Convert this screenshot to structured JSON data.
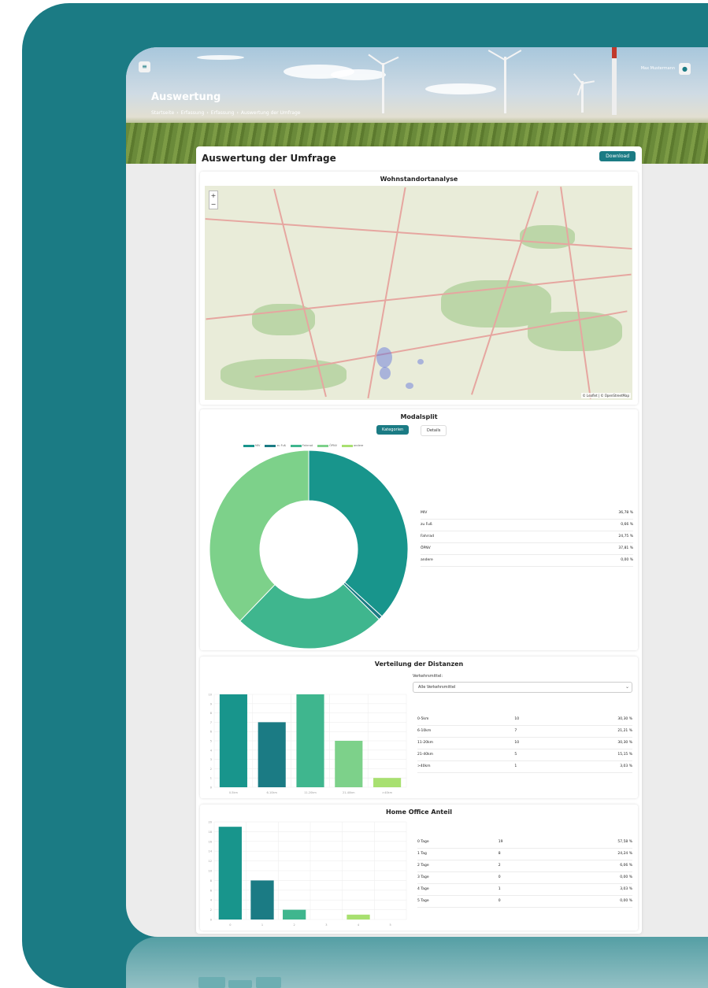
{
  "header": {
    "user_name": "Max Mustermann",
    "title": "Auswertung",
    "breadcrumb": [
      "Startseite",
      "›",
      "Erfassung",
      "›",
      "Erfassung",
      "›",
      "Auswertung der Umfrage"
    ]
  },
  "content": {
    "title": "Auswertung der Umfrage",
    "download_label": "Download"
  },
  "map": {
    "title": "Wohnstandortanalyse",
    "zoom_in": "+",
    "zoom_out": "−",
    "attribution": "© Leaflet | © OpenStreetMap"
  },
  "modalsplit": {
    "title": "Modalsplit",
    "tabs": [
      {
        "label": "Kategorien",
        "active": true
      },
      {
        "label": "Details",
        "active": false
      }
    ],
    "chart_data": {
      "type": "pie",
      "categories": [
        "MIV",
        "zu Fuß",
        "Fahrrad",
        "ÖPNV",
        "andere"
      ],
      "values": [
        36.78,
        0.66,
        24.75,
        37.81,
        0.0
      ],
      "colors": [
        "#18958c",
        "#1b7b84",
        "#3fb68e",
        "#7dd18a",
        "#a8e070"
      ]
    },
    "rows": [
      {
        "label": "MIV",
        "value": "36,78 %"
      },
      {
        "label": "zu Fuß",
        "value": "0,66 %"
      },
      {
        "label": "Fahrrad",
        "value": "24,75 %"
      },
      {
        "label": "ÖPNV",
        "value": "37,81 %"
      },
      {
        "label": "andere",
        "value": "0,00 %"
      }
    ]
  },
  "distances": {
    "title": "Verteilung der Distanzen",
    "select_label": "Verkehrsmittel:",
    "select_value": "Alle Verkehrsmittel",
    "chart_data": {
      "type": "bar",
      "categories": [
        "0-5km",
        "6-10km",
        "11-20km",
        "21-40km",
        ">40km"
      ],
      "values": [
        10,
        7,
        10,
        5,
        1
      ],
      "colors": [
        "#18958c",
        "#1b7b84",
        "#3fb68e",
        "#7dd18a",
        "#a8e070"
      ],
      "ylim": [
        0,
        10
      ],
      "yticks": [
        "0",
        "1",
        "2",
        "3",
        "4",
        "5",
        "6",
        "7",
        "8",
        "9",
        "10"
      ]
    },
    "rows": [
      {
        "label": "0-5km",
        "count": "10",
        "pct": "30,30 %"
      },
      {
        "label": "6-10km",
        "count": "7",
        "pct": "21,21 %"
      },
      {
        "label": "11-20km",
        "count": "10",
        "pct": "30,30 %"
      },
      {
        "label": "21-40km",
        "count": "5",
        "pct": "15,15 %"
      },
      {
        "label": ">40km",
        "count": "1",
        "pct": "3,03 %"
      }
    ]
  },
  "homeoffice": {
    "title": "Home Office Anteil",
    "chart_data": {
      "type": "bar",
      "categories": [
        "0",
        "1",
        "2",
        "3",
        "4",
        "5"
      ],
      "values": [
        19,
        8,
        2,
        0,
        1,
        0
      ],
      "colors": [
        "#18958c",
        "#1b7b84",
        "#3fb68e",
        "#7dd18a",
        "#a8e070",
        "#18958c"
      ],
      "ylim": [
        0,
        20
      ],
      "yticks": [
        "0",
        "2",
        "4",
        "6",
        "8",
        "10",
        "12",
        "14",
        "16",
        "18",
        "20"
      ]
    },
    "rows": [
      {
        "label": "0 Tage",
        "count": "19",
        "pct": "57,58 %"
      },
      {
        "label": "1 Tag",
        "count": "8",
        "pct": "24,24 %"
      },
      {
        "label": "2 Tage",
        "count": "2",
        "pct": "6,06 %"
      },
      {
        "label": "3 Tage",
        "count": "0",
        "pct": "0,00 %"
      },
      {
        "label": "4 Tage",
        "count": "1",
        "pct": "3,03 %"
      },
      {
        "label": "5 Tage",
        "count": "0",
        "pct": "0,00 %"
      }
    ]
  }
}
